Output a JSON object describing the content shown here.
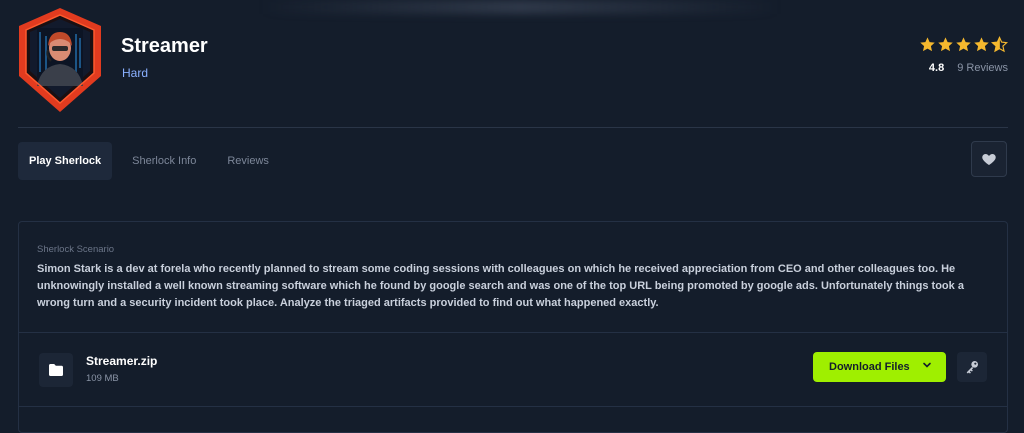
{
  "header": {
    "title": "Streamer",
    "difficulty": "Hard",
    "rating": "4.8",
    "reviews": "9 Reviews",
    "stars": 4.8,
    "logo": "sherlock-avatar-hooded-figure"
  },
  "tabs": [
    {
      "label": "Play Sherlock",
      "active": true
    },
    {
      "label": "Sherlock Info",
      "active": false
    },
    {
      "label": "Reviews",
      "active": false
    }
  ],
  "favorite": {
    "icon": "heart-icon"
  },
  "scenario": {
    "label": "Sherlock Scenario",
    "text": "Simon Stark is a dev at forela who recently planned to stream some coding sessions with colleagues on which he received appreciation from CEO and other colleagues too. He unknowingly installed a well known streaming software which he found by google search and was one of the top URL being promoted by google ads. Unfortunately things took a wrong turn and a security incident took place. Analyze the triaged artifacts provided to find out what happened exactly."
  },
  "file": {
    "name": "Streamer.zip",
    "size": "109 MB",
    "icon": "folder-icon"
  },
  "actions": {
    "download_label": "Download Files",
    "key_icon": "key-icon"
  },
  "colors": {
    "background": "#141d2b",
    "accent": "#9fef00",
    "star": "#f5b82e",
    "difficulty": "#8ab0ff",
    "logo_red": "#e23b1f"
  }
}
